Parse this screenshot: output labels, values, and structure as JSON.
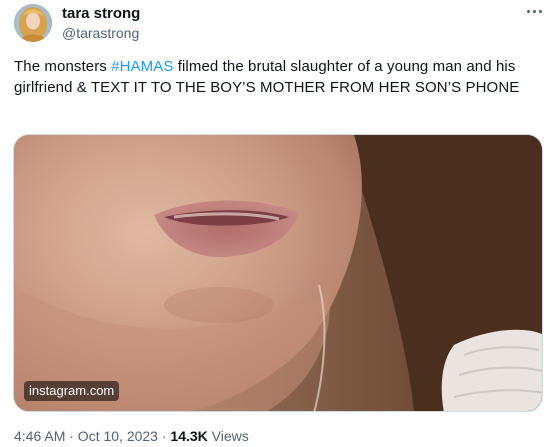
{
  "author": {
    "name": "tara strong",
    "handle": "@tarastrong",
    "avatar_icon": "profile-photo"
  },
  "more_icon": "more-horizontal-icon",
  "tweet": {
    "text_before": "The monsters ",
    "hashtag": "#HAMAS",
    "text_after": " filmed the brutal slaughter of a young man and his girlfriend & TEXT IT TO THE BOY’S MOTHER FROM HER SON’S PHONE"
  },
  "media": {
    "watermark": "instagram.com"
  },
  "meta": {
    "timestamp": "4:46 AM · Oct 10, 2023 · ",
    "views_count": "14.3K",
    "views_label": " Views"
  },
  "colors": {
    "link": "#1d9bf0",
    "secondary_text": "#536471",
    "primary_text": "#0f1419"
  }
}
